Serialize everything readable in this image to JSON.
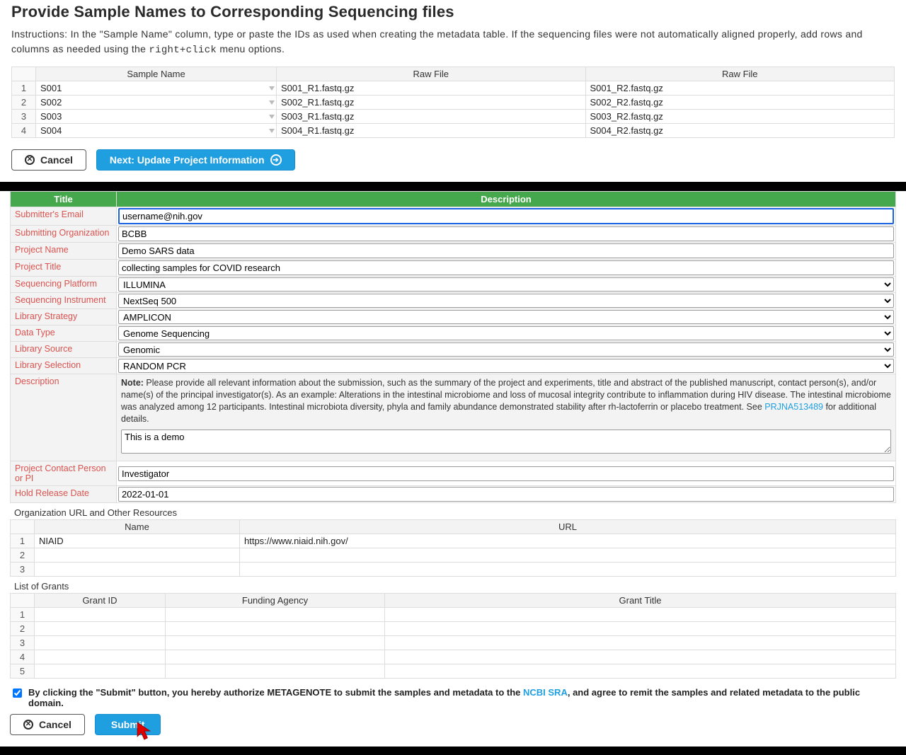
{
  "section1": {
    "title": "Provide Sample Names to Corresponding Sequencing files",
    "instructions_pre": "Instructions: In the \"Sample Name\" column, type or paste the IDs as used when creating the metadata table. If the sequencing files were not automatically aligned properly, add rows and columns as needed using the ",
    "instructions_code": "right+click",
    "instructions_post": " menu options.",
    "columns": [
      "Sample Name",
      "Raw File",
      "Raw File"
    ],
    "rows": [
      {
        "n": "1",
        "sample": "S001",
        "r1": "S001_R1.fastq.gz",
        "r2": "S001_R2.fastq.gz"
      },
      {
        "n": "2",
        "sample": "S002",
        "r1": "S002_R1.fastq.gz",
        "r2": "S002_R2.fastq.gz"
      },
      {
        "n": "3",
        "sample": "S003",
        "r1": "S003_R1.fastq.gz",
        "r2": "S003_R2.fastq.gz"
      },
      {
        "n": "4",
        "sample": "S004",
        "r1": "S004_R1.fastq.gz",
        "r2": "S004_R2.fastq.gz"
      }
    ],
    "cancel_label": "Cancel",
    "next_label": "Next: Update Project Information"
  },
  "form": {
    "head_title": "Title",
    "head_desc": "Description",
    "rows": {
      "email": {
        "label": "Submitter's Email",
        "value": "username@nih.gov"
      },
      "org": {
        "label": "Submitting Organization",
        "value": "BCBB"
      },
      "pname": {
        "label": "Project Name",
        "value": "Demo SARS data"
      },
      "ptitle": {
        "label": "Project Title",
        "value": "collecting samples for COVID research"
      },
      "platform": {
        "label": "Sequencing Platform",
        "value": "ILLUMINA"
      },
      "instrument": {
        "label": "Sequencing Instrument",
        "value": "NextSeq 500"
      },
      "strategy": {
        "label": "Library Strategy",
        "value": "AMPLICON"
      },
      "dtype": {
        "label": "Data Type",
        "value": "Genome Sequencing"
      },
      "source": {
        "label": "Library Source",
        "value": "Genomic"
      },
      "selection": {
        "label": "Library Selection",
        "value": "RANDOM PCR"
      },
      "desc": {
        "label": "Description",
        "note_bold": "Note:",
        "note_text": " Please provide all relevant information about the submission, such as the summary of the project and experiments, title and abstract of the published manuscript, contact person(s), and/or name(s) of the principal investigator(s). As an example: Alterations in the intestinal microbiome and loss of mucosal integrity contribute to inflammation during HIV disease. The intestinal microbiome was analyzed among 12 participants. Intestinal microbiota diversity, phyla and family abundance demonstrated stability after rh-lactoferrin or placebo treatment. See ",
        "note_link": "PRJNA513489",
        "note_after": " for additional details.",
        "value": "This is a demo"
      },
      "contact": {
        "label": "Project Contact Person or PI",
        "value": "Investigator"
      },
      "hold": {
        "label": "Hold Release Date",
        "value": "2022-01-01"
      }
    },
    "org_heading": "Organization URL and Other Resources",
    "org_cols": [
      "Name",
      "URL"
    ],
    "org_rows": [
      {
        "n": "1",
        "name": "NIAID",
        "url": "https://www.niaid.nih.gov/"
      },
      {
        "n": "2",
        "name": "",
        "url": ""
      },
      {
        "n": "3",
        "name": "",
        "url": ""
      }
    ],
    "grants_heading": "List of Grants",
    "grants_cols": [
      "Grant ID",
      "Funding Agency",
      "Grant Title"
    ],
    "grants_rows": [
      {
        "n": "1"
      },
      {
        "n": "2"
      },
      {
        "n": "3"
      },
      {
        "n": "4"
      },
      {
        "n": "5"
      }
    ],
    "authorize_pre": "By clicking the \"Submit\" button, you hereby authorize METAGENOTE to submit the samples and metadata to the ",
    "authorize_link": "NCBI SRA",
    "authorize_post": ", and agree to remit the samples and related metadata to the public domain.",
    "cancel_label": "Cancel",
    "submit_label": "Submit"
  }
}
